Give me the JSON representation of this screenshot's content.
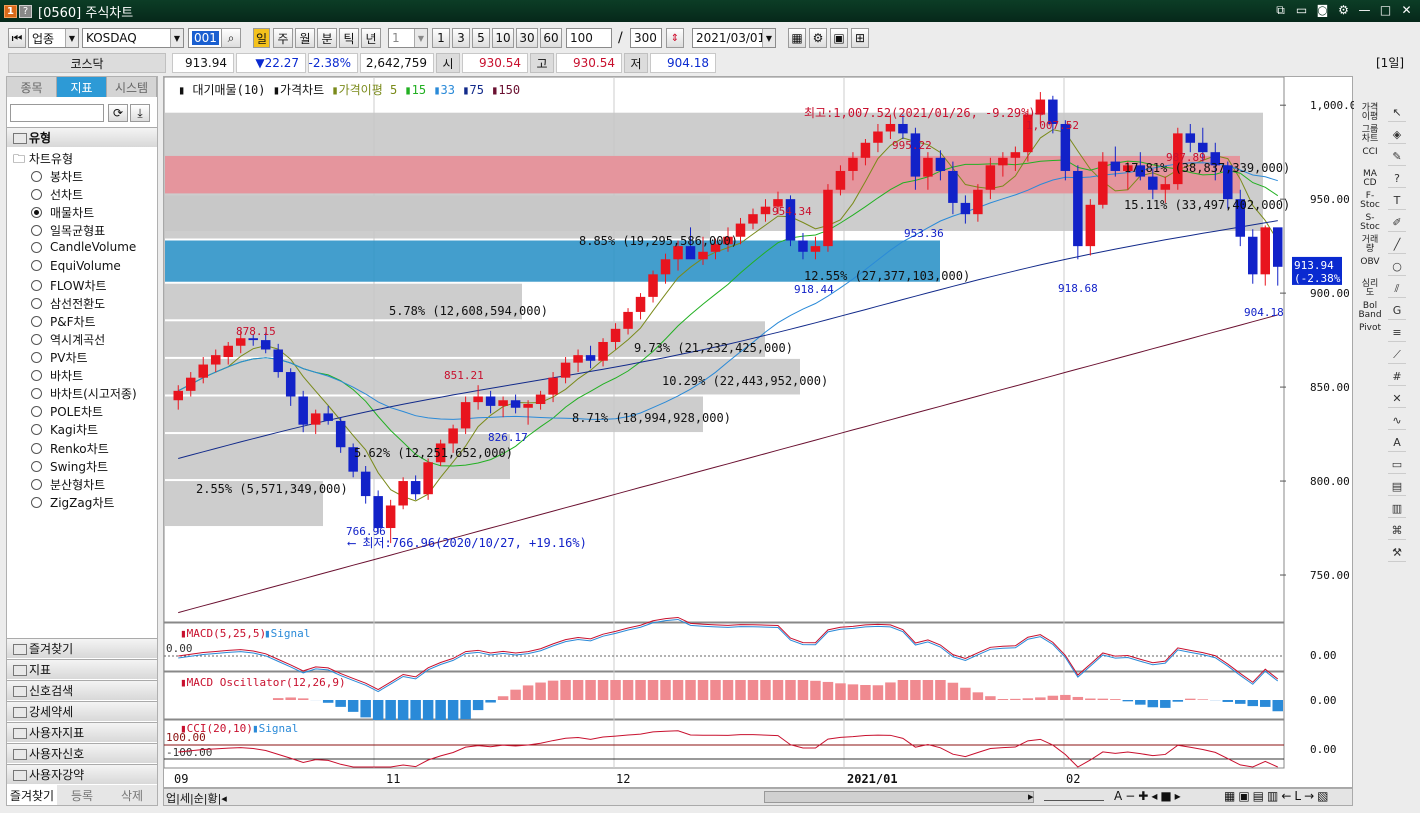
{
  "window": {
    "num": "1",
    "help": "?",
    "title": "[0560] 주식차트"
  },
  "toolbar": {
    "market": "업종",
    "index": "KOSDAQ",
    "code": "001",
    "periods": [
      "일",
      "주",
      "월",
      "분",
      "틱",
      "년"
    ],
    "interval": "1",
    "intervals": [
      "1",
      "3",
      "5",
      "10",
      "30",
      "60"
    ],
    "count": "100",
    "total": "300",
    "date": "2021/03/01"
  },
  "quote": {
    "name": "코스닥",
    "price": "913.94",
    "change": "▼22.27",
    "rate": "-2.38%",
    "volume": "2,642,759",
    "open_label": "시",
    "open": "930.54",
    "high_label": "고",
    "high": "930.54",
    "low_label": "저",
    "low": "904.18",
    "period": "[1일]"
  },
  "left": {
    "tabs": [
      "종목",
      "지표",
      "시스템"
    ],
    "section_type": "유형",
    "tree_root": "차트유형",
    "types": [
      "봉차트",
      "선차트",
      "매물차트",
      "일목균형표",
      "CandleVolume",
      "EquiVolume",
      "FLOW차트",
      "삼선전환도",
      "P&F차트",
      "역시계곡선",
      "PV차트",
      "바차트",
      "바차트(시고저종)",
      "POLE차트",
      "Kagi차트",
      "Renko차트",
      "Swing차트",
      "분산형차트",
      "ZigZag차트"
    ],
    "selected_index": 2,
    "sections": [
      "즐겨찾기",
      "지표",
      "신호검색",
      "강세약세",
      "사용자지표",
      "사용자신호",
      "사용자강약"
    ],
    "bottom_tabs": [
      "즐겨찾기",
      "등록",
      "삭제"
    ]
  },
  "chart": {
    "legend": {
      "volume": "대기매물(10)",
      "price": "가격차트",
      "ma": "가격이평",
      "ma_periods": [
        "5",
        "15",
        "33",
        "75",
        "150"
      ]
    },
    "high_note": "최고:1,007.52(2021/01/26, -9.29%)⟶",
    "low_note": "⟵ 최저:766.96(2020/10/27, +19.16%)",
    "price_labels": [
      "878.15",
      "766.96",
      "851.21",
      "826.17",
      "954.34",
      "918.44",
      "995.22",
      "953.36",
      "1,007.52",
      "918.68",
      "987.89",
      "904.18"
    ],
    "volume_labels": [
      "17.81% (38,837,339,000)",
      "8.85% (19,295,586,000)",
      "12.55% (27,377,103,000)",
      "5.78% (12,608,594,000)",
      "9.73% (21,232,425,000)",
      "10.29% (22,443,952,000)",
      "8.71% (18,994,928,000)",
      "5.62% (12,251,652,000)",
      "2.55% (5,571,349,000)",
      "15.11% (33,497,402,000)"
    ],
    "y_ticks": [
      "1,000.00",
      "950.00",
      "900.00",
      "850.00",
      "800.00",
      "750.00"
    ],
    "y_range": [
      725,
      1015
    ],
    "current": {
      "price": "913.94",
      "rate": "(-2.38%)"
    },
    "x_ticks": [
      "09",
      "11",
      "12",
      "2021/01",
      "02"
    ],
    "macd": {
      "label": "MACD(5,25,5)",
      "signal": "Signal",
      "zero": "0.00",
      "level_left": "0.00"
    },
    "osc": {
      "label": "MACD Oscillator(12,26,9)",
      "zero": "0.00"
    },
    "cci": {
      "label": "CCI(20,10)",
      "signal": "Signal",
      "zero": "0.00",
      "upper": "100.00",
      "lower": "-100.00"
    }
  },
  "chart_data": {
    "type": "candlestick",
    "title": "",
    "y_range": [
      725,
      1015
    ],
    "candles": [
      [
        843,
        851,
        838,
        848
      ],
      [
        848,
        858,
        845,
        855
      ],
      [
        855,
        866,
        852,
        862
      ],
      [
        862,
        870,
        858,
        867
      ],
      [
        866,
        874,
        862,
        872
      ],
      [
        872,
        880,
        868,
        876
      ],
      [
        876,
        878,
        872,
        875
      ],
      [
        875,
        879,
        868,
        870
      ],
      [
        870,
        873,
        855,
        858
      ],
      [
        858,
        860,
        840,
        845
      ],
      [
        845,
        848,
        826,
        830
      ],
      [
        830,
        838,
        825,
        836
      ],
      [
        836,
        840,
        830,
        832
      ],
      [
        832,
        834,
        815,
        818
      ],
      [
        818,
        820,
        802,
        805
      ],
      [
        805,
        808,
        788,
        792
      ],
      [
        792,
        795,
        772,
        775
      ],
      [
        775,
        790,
        767,
        787
      ],
      [
        787,
        802,
        785,
        800
      ],
      [
        800,
        803,
        790,
        793
      ],
      [
        793,
        812,
        790,
        810
      ],
      [
        810,
        822,
        808,
        820
      ],
      [
        820,
        830,
        815,
        828
      ],
      [
        828,
        845,
        825,
        842
      ],
      [
        842,
        851,
        838,
        845
      ],
      [
        845,
        848,
        836,
        840
      ],
      [
        840,
        845,
        834,
        843
      ],
      [
        843,
        846,
        836,
        839
      ],
      [
        839,
        843,
        830,
        841
      ],
      [
        841,
        848,
        838,
        846
      ],
      [
        846,
        858,
        842,
        855
      ],
      [
        855,
        866,
        852,
        863
      ],
      [
        863,
        870,
        858,
        867
      ],
      [
        867,
        872,
        860,
        864
      ],
      [
        864,
        876,
        861,
        874
      ],
      [
        874,
        884,
        870,
        881
      ],
      [
        881,
        892,
        878,
        890
      ],
      [
        890,
        900,
        886,
        898
      ],
      [
        898,
        912,
        895,
        910
      ],
      [
        910,
        921,
        905,
        918
      ],
      [
        918,
        928,
        912,
        925
      ],
      [
        925,
        935,
        919,
        918
      ],
      [
        918,
        930,
        915,
        922
      ],
      [
        922,
        929,
        918,
        926
      ],
      [
        926,
        935,
        922,
        930
      ],
      [
        930,
        940,
        926,
        937
      ],
      [
        937,
        945,
        934,
        942
      ],
      [
        942,
        950,
        938,
        946
      ],
      [
        946,
        954,
        942,
        950
      ],
      [
        950,
        952,
        925,
        928
      ],
      [
        928,
        932,
        918,
        922
      ],
      [
        922,
        930,
        918,
        925
      ],
      [
        925,
        958,
        922,
        955
      ],
      [
        955,
        968,
        952,
        965
      ],
      [
        965,
        975,
        960,
        972
      ],
      [
        972,
        982,
        968,
        980
      ],
      [
        980,
        990,
        975,
        986
      ],
      [
        986,
        995,
        982,
        990
      ],
      [
        990,
        995,
        982,
        985
      ],
      [
        985,
        988,
        955,
        962
      ],
      [
        962,
        975,
        955,
        972
      ],
      [
        972,
        976,
        960,
        965
      ],
      [
        965,
        970,
        942,
        948
      ],
      [
        948,
        952,
        937,
        942
      ],
      [
        942,
        958,
        938,
        955
      ],
      [
        955,
        972,
        950,
        968
      ],
      [
        968,
        975,
        962,
        972
      ],
      [
        972,
        978,
        965,
        975
      ],
      [
        975,
        998,
        970,
        995
      ],
      [
        995,
        1007,
        990,
        1003
      ],
      [
        1003,
        1005,
        985,
        990
      ],
      [
        990,
        992,
        960,
        965
      ],
      [
        965,
        968,
        918,
        925
      ],
      [
        925,
        950,
        920,
        947
      ],
      [
        947,
        975,
        945,
        970
      ],
      [
        970,
        978,
        962,
        965
      ],
      [
        965,
        970,
        955,
        968
      ],
      [
        968,
        975,
        960,
        962
      ],
      [
        962,
        966,
        950,
        955
      ],
      [
        955,
        962,
        948,
        958
      ],
      [
        958,
        988,
        955,
        985
      ],
      [
        985,
        990,
        975,
        980
      ],
      [
        980,
        988,
        970,
        975
      ],
      [
        975,
        980,
        960,
        968
      ],
      [
        968,
        970,
        945,
        950
      ],
      [
        950,
        955,
        925,
        930
      ],
      [
        930,
        934,
        905,
        910
      ],
      [
        910,
        936,
        904,
        935
      ],
      [
        935,
        934,
        904,
        914
      ]
    ]
  },
  "toolbar_icons": [
    "chart-type-icon",
    "settings-icon",
    "save-icon",
    "export-icon"
  ]
}
